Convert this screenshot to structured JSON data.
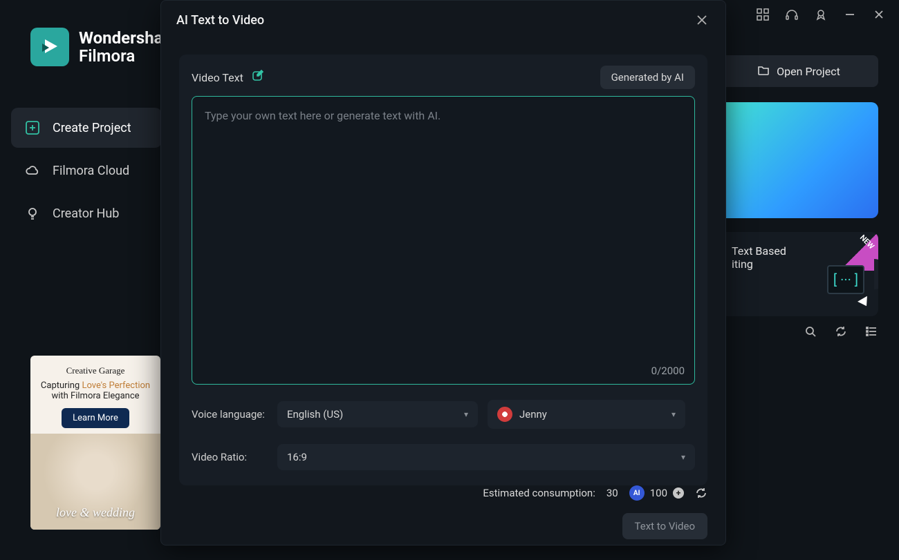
{
  "app": {
    "brand_line1": "Wondersha",
    "brand_line2": "Filmora"
  },
  "sidebar": {
    "items": [
      {
        "label": "Create Project"
      },
      {
        "label": "Filmora Cloud"
      },
      {
        "label": "Creator Hub"
      }
    ]
  },
  "promo": {
    "script": "Creative Garage",
    "line_prefix": "Capturing ",
    "line_love": "Love's Perfection",
    "line2": "with Filmora Elegance",
    "cta": "Learn More",
    "overlay": "love & wedding"
  },
  "right": {
    "open_project": "Open Project",
    "feature_title_l1": "Text Based",
    "feature_title_l2": "iting",
    "feature_box": "[ ··· ]",
    "new_badge": "NEW"
  },
  "modal": {
    "title": "AI Text to Video",
    "video_text_label": "Video Text",
    "generated_by_ai": "Generated by AI",
    "textarea_placeholder": "Type your own text here or generate text with AI.",
    "char_count": "0/2000",
    "voice_language_label": "Voice language:",
    "voice_language_value": "English (US)",
    "voice_name": "Jenny",
    "video_ratio_label": "Video Ratio:",
    "video_ratio_value": "16:9",
    "est_consumption_label": "Estimated consumption:",
    "est_consumption_value": "30",
    "ai_badge": "AI",
    "credits": "100",
    "ttv_button": "Text to Video"
  }
}
